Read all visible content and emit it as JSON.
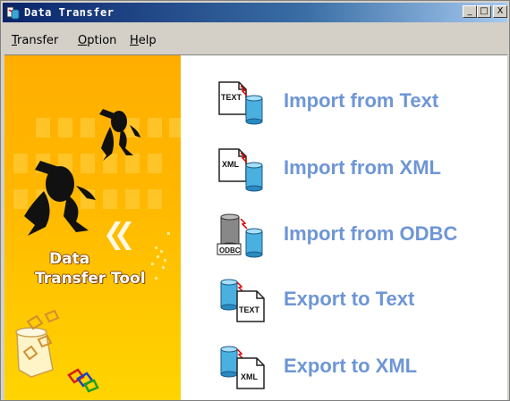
{
  "window": {
    "title": "Data Transfer",
    "controls": {
      "minimize": "_",
      "maximize": "□",
      "close": "X"
    }
  },
  "menu": {
    "items": [
      {
        "first": "T",
        "rest": "ransfer"
      },
      {
        "first": "O",
        "rest": "ption"
      },
      {
        "first": "H",
        "rest": "elp"
      }
    ]
  },
  "banner": {
    "line1": "Data",
    "line2": "Transfer Tool"
  },
  "actions": [
    {
      "label": "Import from Text",
      "icon": "import-text-icon",
      "badge": "TEXT"
    },
    {
      "label": "Import from XML",
      "icon": "import-xml-icon",
      "badge": "XML"
    },
    {
      "label": "Import from ODBC",
      "icon": "import-odbc-icon",
      "badge": "ODBC"
    },
    {
      "label": "Export to Text",
      "icon": "export-text-icon",
      "badge": "TEXT"
    },
    {
      "label": "Export to XML",
      "icon": "export-xml-icon",
      "badge": "XML"
    }
  ],
  "colors": {
    "action_text": "#6e96d6",
    "banner": "#ffb700",
    "titlebar": "#0a246a"
  }
}
